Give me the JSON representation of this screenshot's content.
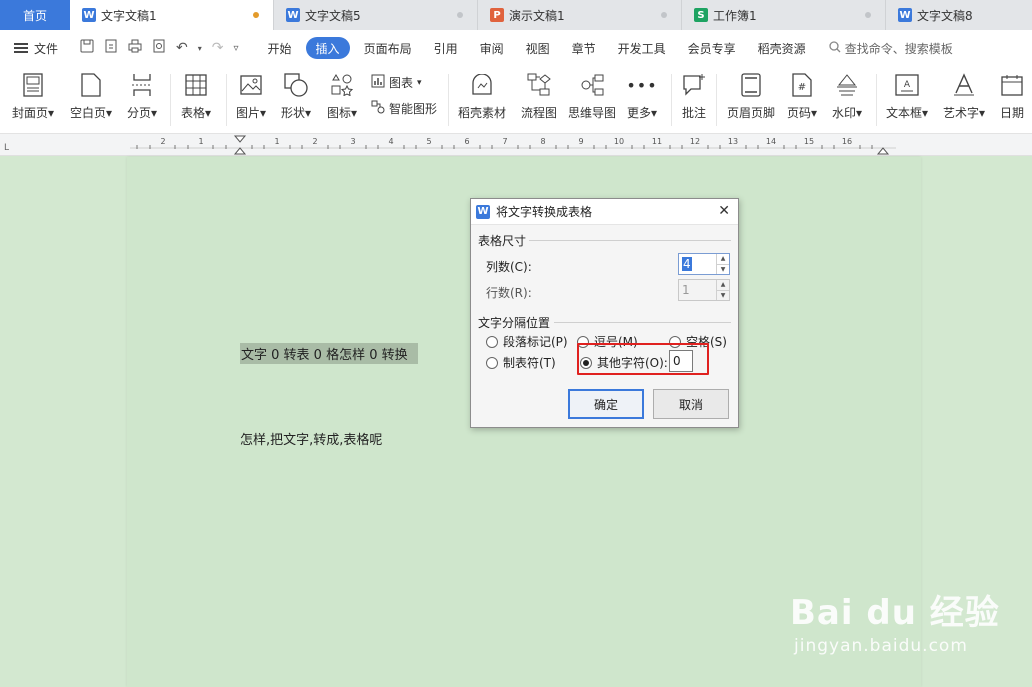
{
  "tabs": {
    "home": "首页",
    "items": [
      {
        "label": "文字文稿1",
        "icon": "W",
        "color": "#3b79db",
        "active": true
      },
      {
        "label": "文字文稿5",
        "icon": "W",
        "color": "#3b79db",
        "active": false
      },
      {
        "label": "演示文稿1",
        "icon": "P",
        "color": "#e0623d",
        "active": false
      },
      {
        "label": "工作簿1",
        "icon": "S",
        "color": "#1ea362",
        "active": false
      },
      {
        "label": "文字文稿8",
        "icon": "W",
        "color": "#3b79db",
        "active": false
      }
    ]
  },
  "menu": {
    "file_label": "文件",
    "tabs": [
      "开始",
      "插入",
      "页面布局",
      "引用",
      "审阅",
      "视图",
      "章节",
      "开发工具",
      "会员专享",
      "稻壳资源"
    ],
    "active_tab": "插入",
    "search_placeholder": "查找命令、搜索模板"
  },
  "ribbon": {
    "cover_page": "封面页",
    "blank_page": "空白页",
    "page_break": "分页",
    "table": "表格",
    "picture": "图片",
    "shape": "形状",
    "icon": "图标",
    "chart": "图表",
    "smart_art": "智能图形",
    "docer_material": "稻壳素材",
    "flowchart": "流程图",
    "mind_map": "思维导图",
    "more": "更多",
    "comment": "批注",
    "header_footer": "页眉页脚",
    "page_number": "页码",
    "watermark": "水印",
    "text_box": "文本框",
    "word_art": "艺术字",
    "date": "日期"
  },
  "document": {
    "line1": "文字 0 转表 0 格怎样 0 转换",
    "line2": "怎样,把文字,转成,表格呢"
  },
  "dialog": {
    "title": "将文字转换成表格",
    "size_group": "表格尺寸",
    "columns_label": "列数(C):",
    "columns_value": "4",
    "rows_label": "行数(R):",
    "rows_value": "1",
    "separator_group": "文字分隔位置",
    "opt_paragraph": "段落标记(P)",
    "opt_comma": "逗号(M)",
    "opt_space": "空格(S)",
    "opt_tab": "制表符(T)",
    "opt_other": "其他字符(O):",
    "other_value": "0",
    "ok": "确定",
    "cancel": "取消"
  },
  "watermark": {
    "brand": "Bai du 经验",
    "url": "jingyan.baidu.com"
  }
}
